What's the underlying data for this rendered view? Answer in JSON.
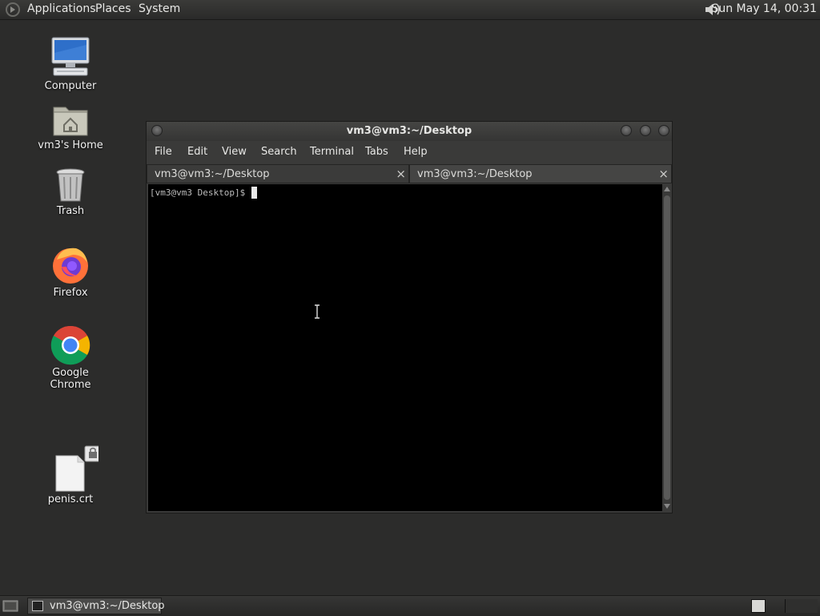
{
  "top_panel": {
    "menus": [
      "Applications",
      "Places",
      "System"
    ],
    "clock": "Sun May 14, 00:31"
  },
  "desktop": {
    "icons": [
      {
        "label": "Computer",
        "icon": "computer-icon"
      },
      {
        "label": "vm3's Home",
        "icon": "home-folder-icon"
      },
      {
        "label": "Trash",
        "icon": "trash-icon"
      },
      {
        "label": "Firefox",
        "icon": "firefox-icon"
      },
      {
        "label": "Google Chrome",
        "icon": "chrome-icon"
      },
      {
        "label": "penis.crt",
        "icon": "certificate-file-icon"
      }
    ]
  },
  "terminal": {
    "title": "vm3@vm3:~/Desktop",
    "menus": [
      "File",
      "Edit",
      "View",
      "Search",
      "Terminal",
      "Tabs",
      "Help"
    ],
    "tabs": [
      {
        "label": "vm3@vm3:~/Desktop",
        "close": "×"
      },
      {
        "label": "vm3@vm3:~/Desktop",
        "close": "×"
      }
    ],
    "prompt": "[vm3@vm3 Desktop]$ "
  },
  "taskbar": {
    "window_label": "vm3@vm3:~/Desktop"
  },
  "colors": {
    "desktop_bg": "#2c2c2b",
    "panel_bg": "#2f2f2e",
    "terminal_bg": "#000000",
    "terminal_fg": "#bdbdbd"
  }
}
